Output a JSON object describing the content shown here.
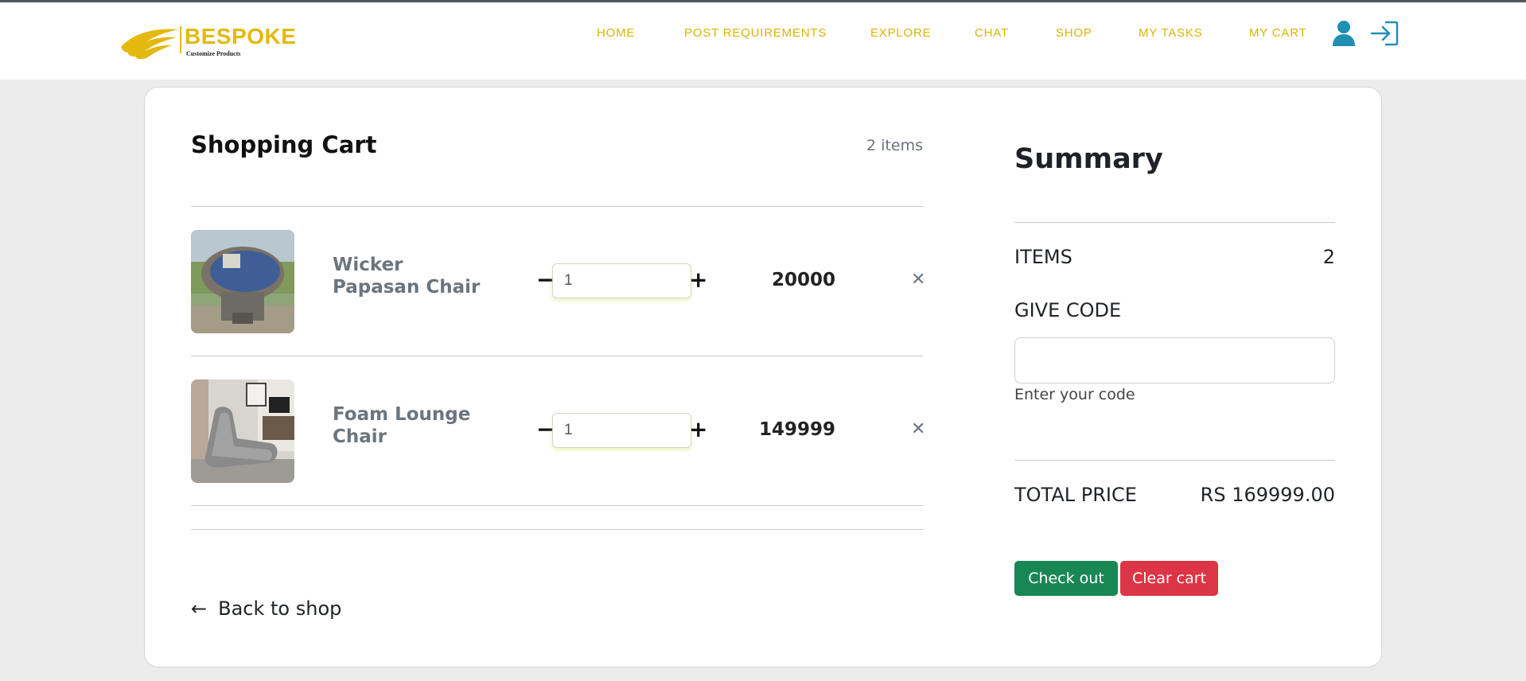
{
  "brand": {
    "name": "BESPOKE",
    "tagline": "Customize Products",
    "accent": "#e3b90d"
  },
  "nav": {
    "links": [
      "HOME",
      "POST REQUIREMENTS",
      "EXPLORE",
      "CHAT",
      "SHOP",
      "MY TASKS",
      "MY CART"
    ],
    "icons": [
      "user-icon",
      "login-icon"
    ]
  },
  "cart": {
    "title": "Shopping Cart",
    "count_label": "2 items",
    "items": [
      {
        "name": "Wicker Papasan Chair",
        "quantity": "1",
        "price": "20000",
        "image": "papasan-chair-thumbnail",
        "remove_symbol": "✕"
      },
      {
        "name": "Foam Lounge Chair",
        "quantity": "1",
        "price": "149999",
        "image": "lounge-chair-thumbnail",
        "remove_symbol": "✕"
      }
    ],
    "qty_minus": "−",
    "qty_plus": "+",
    "back_label": "Back to shop",
    "back_arrow": "←"
  },
  "summary": {
    "title": "Summary",
    "items_label": "ITEMS",
    "items_value": "2",
    "code_label": "GIVE CODE",
    "code_value": "",
    "code_hint": "Enter your code",
    "total_label": "TOTAL PRICE",
    "total_value": "RS 169999.00",
    "checkout_label": "Check out",
    "clear_label": "Clear cart"
  },
  "colors": {
    "nav_link": "#d9b40a",
    "icon": "#1f8fb4",
    "checkout": "#198754",
    "clear": "#dc3545"
  }
}
